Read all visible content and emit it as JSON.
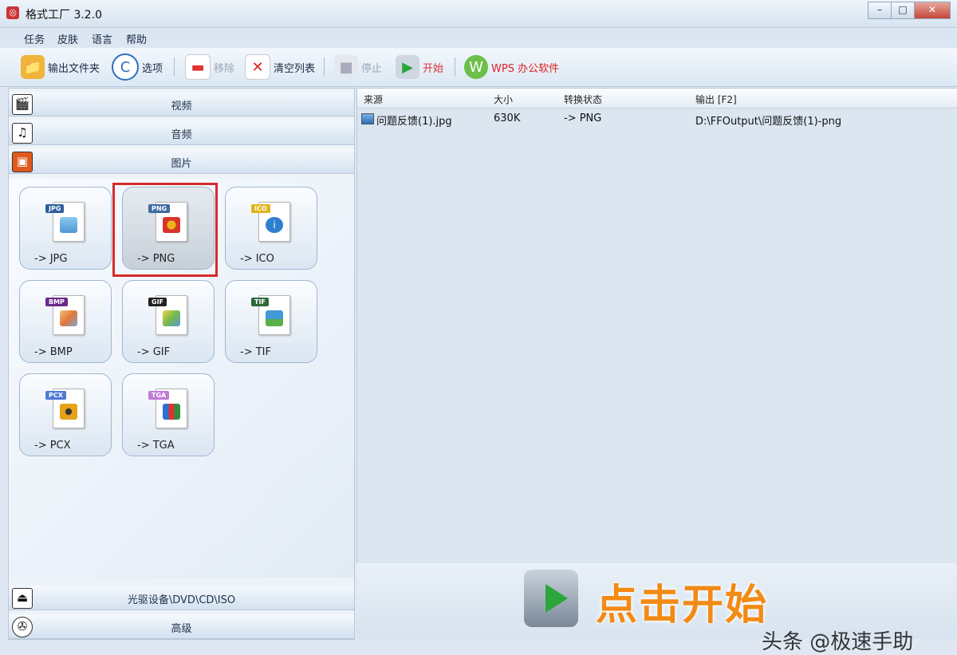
{
  "window": {
    "title": "格式工厂 3.2.0"
  },
  "menu": [
    "任务",
    "皮肤",
    "语言",
    "帮助"
  ],
  "toolbar": {
    "output_folder": "输出文件夹",
    "options": "选项",
    "remove": "移除",
    "clear_list": "清空列表",
    "stop": "停止",
    "start": "开始",
    "wps": "WPS 办公软件"
  },
  "categories": {
    "video": "视频",
    "audio": "音频",
    "image": "图片",
    "rom": "光驱设备\\DVD\\CD\\ISO",
    "advanced": "高级"
  },
  "formats": [
    {
      "badge": "JPG",
      "label": "-> JPG",
      "badge_color": "#2d5f9e",
      "pic_color": "#4e97d1"
    },
    {
      "badge": "PNG",
      "label": "-> PNG",
      "badge_color": "#3f6aa3",
      "pic_color": "#d9342c"
    },
    {
      "badge": "ICO",
      "label": "-> ICO",
      "badge_color": "#e0b41a",
      "pic_color": "#2f7fd1"
    },
    {
      "badge": "BMP",
      "label": "-> BMP",
      "badge_color": "#6b2a8a",
      "pic_color": "#e0783a"
    },
    {
      "badge": "GIF",
      "label": "-> GIF",
      "badge_color": "#222222",
      "pic_color": "#73b84d"
    },
    {
      "badge": "TIF",
      "label": "-> TIF",
      "badge_color": "#2f6a3a",
      "pic_color": "#3f9ad6"
    },
    {
      "badge": "PCX",
      "label": "-> PCX",
      "badge_color": "#4f7ad6",
      "pic_color": "#e5a21a"
    },
    {
      "badge": "TGA",
      "label": "-> TGA",
      "badge_color": "#c07ad6",
      "pic_color": "#2f8f3f"
    }
  ],
  "selected_format": "PNG",
  "table": {
    "headers": {
      "source": "来源",
      "size": "大小",
      "status": "转换状态",
      "output": "输出 [F2]"
    },
    "rows": [
      {
        "source": "问题反馈(1).jpg",
        "size": "630K",
        "status": "-> PNG",
        "output": "D:\\FFOutput\\问题反馈(1)-png"
      }
    ]
  },
  "banner": {
    "text": "点击开始"
  },
  "watermark": "头条 @极速手助"
}
